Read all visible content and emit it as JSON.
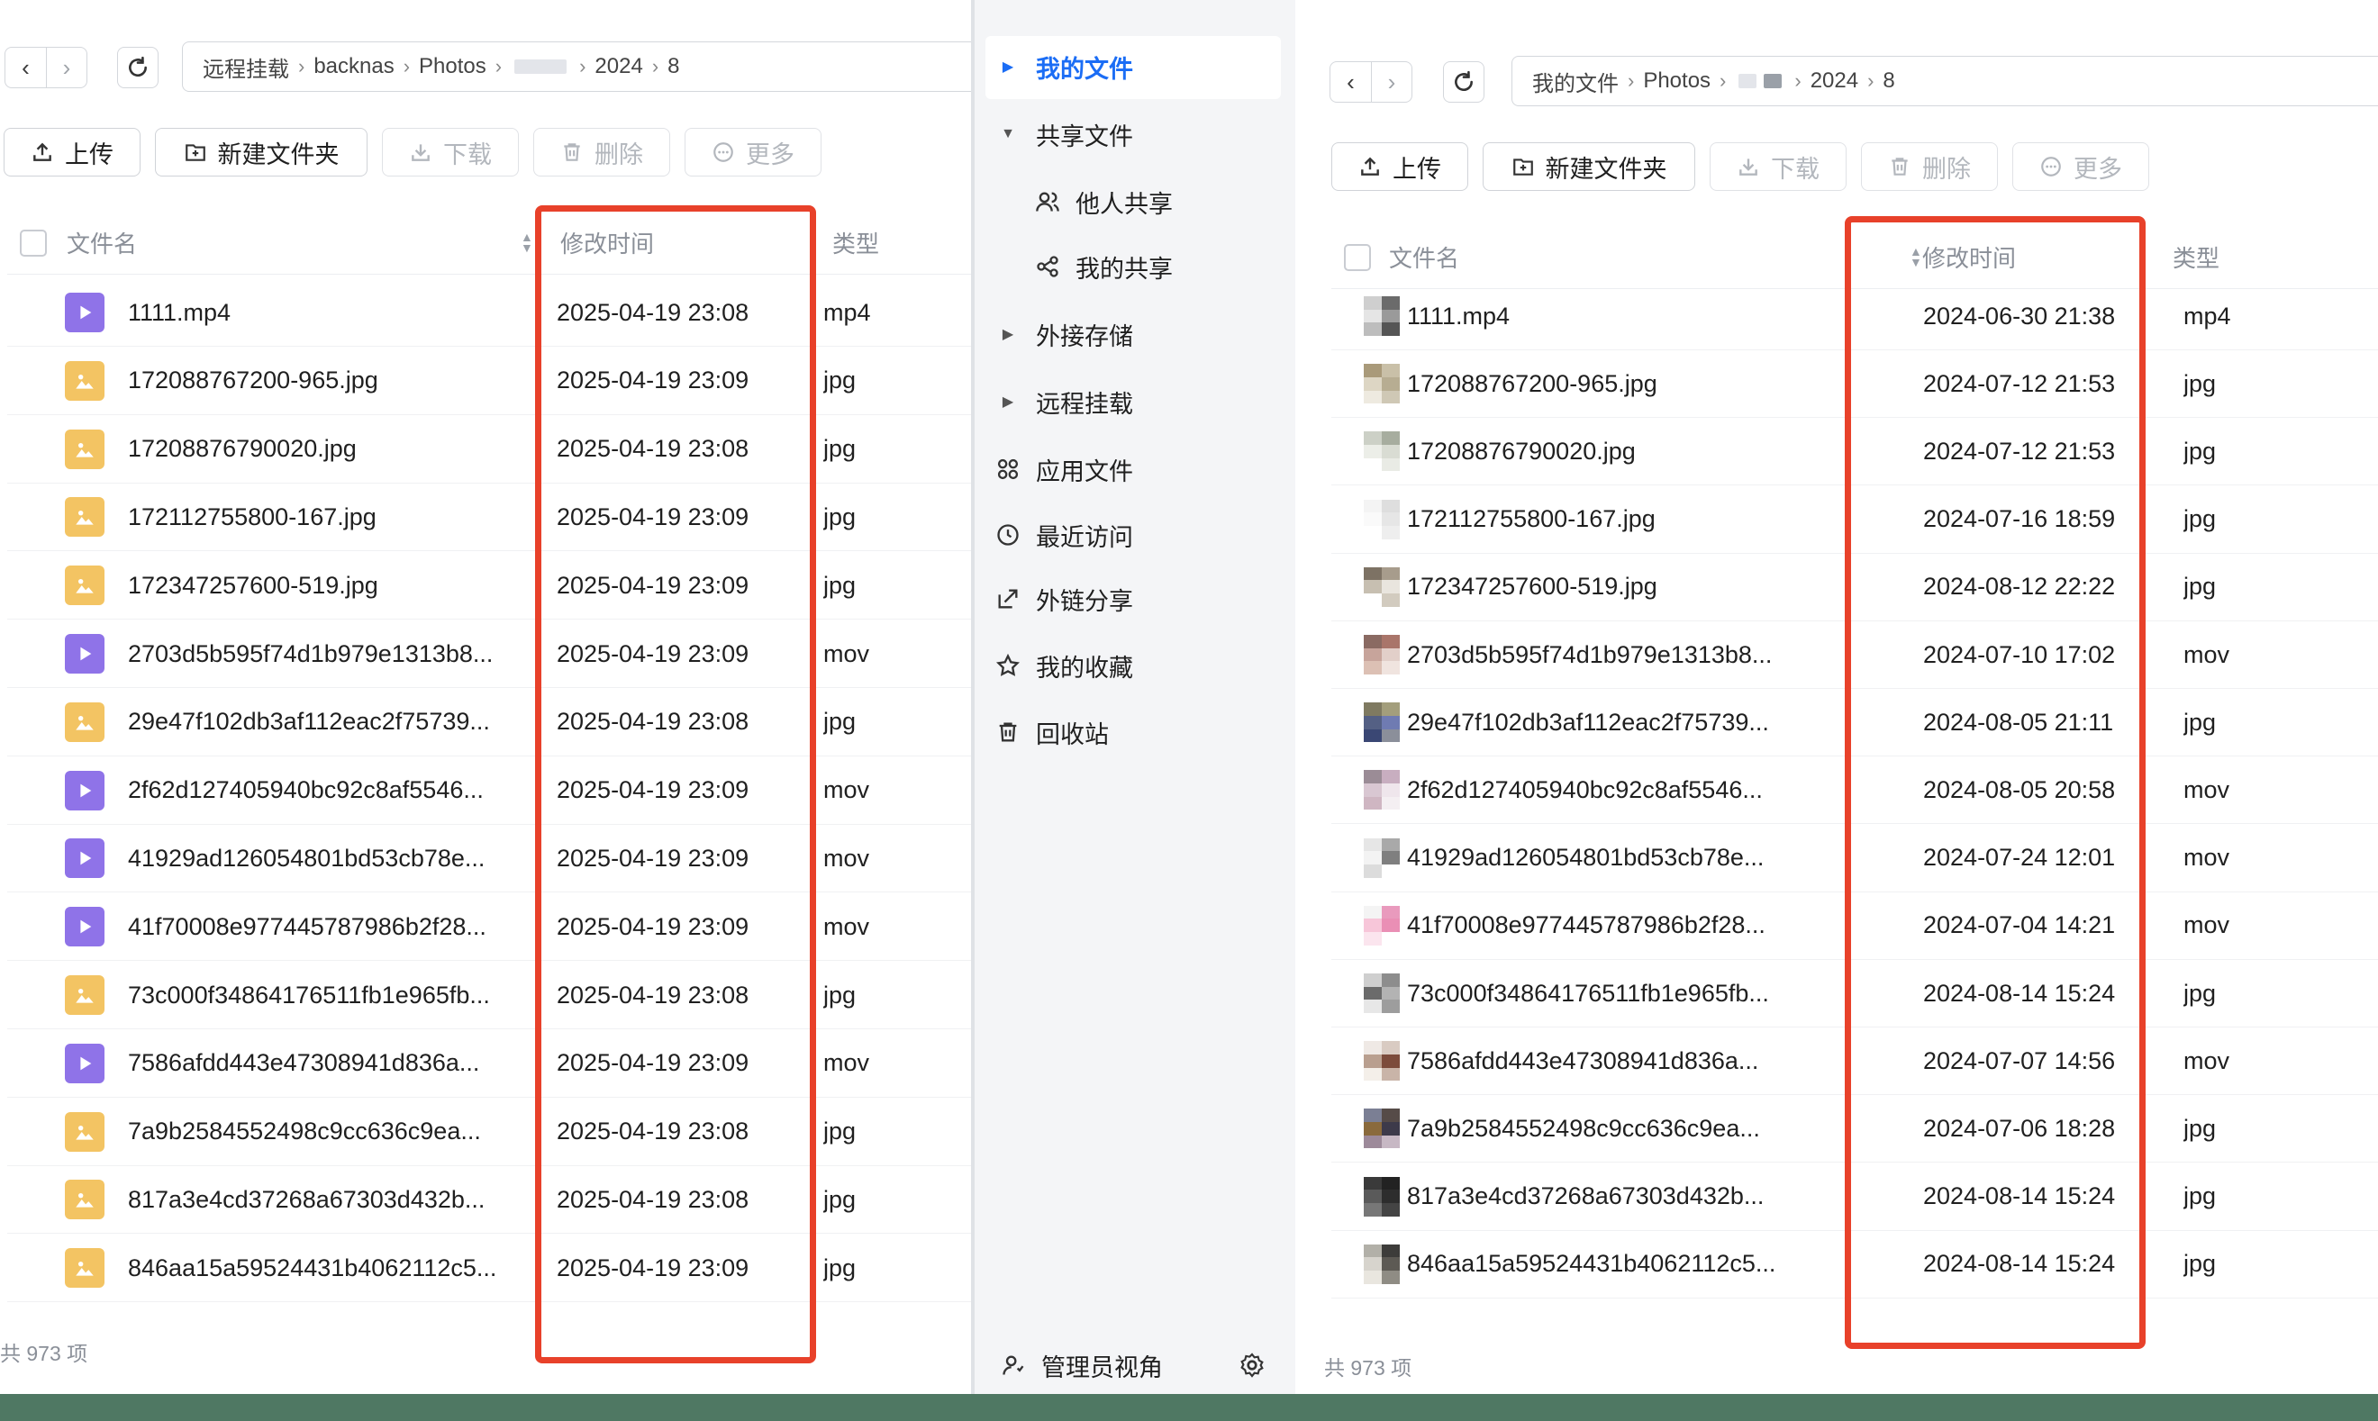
{
  "left": {
    "breadcrumb": [
      "远程挂载",
      "backnas",
      "Photos",
      "2024",
      "8"
    ],
    "toolbar": {
      "upload": "上传",
      "new_folder": "新建文件夹",
      "download": "下载",
      "delete": "删除",
      "more": "更多"
    },
    "columns": {
      "name": "文件名",
      "modified": "修改时间",
      "type": "类型"
    },
    "files": [
      {
        "name": "1111.mp4",
        "modified": "2025-04-19 23:08",
        "type": "mp4",
        "kind": "video"
      },
      {
        "name": "172088767200-965.jpg",
        "modified": "2025-04-19 23:09",
        "type": "jpg",
        "kind": "image"
      },
      {
        "name": "17208876790020.jpg",
        "modified": "2025-04-19 23:08",
        "type": "jpg",
        "kind": "image"
      },
      {
        "name": "172112755800-167.jpg",
        "modified": "2025-04-19 23:09",
        "type": "jpg",
        "kind": "image"
      },
      {
        "name": "172347257600-519.jpg",
        "modified": "2025-04-19 23:09",
        "type": "jpg",
        "kind": "image"
      },
      {
        "name": "2703d5b595f74d1b979e1313b8...",
        "modified": "2025-04-19 23:09",
        "type": "mov",
        "kind": "video"
      },
      {
        "name": "29e47f102db3af112eac2f75739...",
        "modified": "2025-04-19 23:08",
        "type": "jpg",
        "kind": "image"
      },
      {
        "name": "2f62d127405940bc92c8af5546...",
        "modified": "2025-04-19 23:09",
        "type": "mov",
        "kind": "video"
      },
      {
        "name": "41929ad126054801bd53cb78e...",
        "modified": "2025-04-19 23:09",
        "type": "mov",
        "kind": "video"
      },
      {
        "name": "41f70008e977445787986b2f28...",
        "modified": "2025-04-19 23:09",
        "type": "mov",
        "kind": "video"
      },
      {
        "name": "73c000f34864176511fb1e965fb...",
        "modified": "2025-04-19 23:08",
        "type": "jpg",
        "kind": "image"
      },
      {
        "name": "7586afdd443e47308941d836a...",
        "modified": "2025-04-19 23:09",
        "type": "mov",
        "kind": "video"
      },
      {
        "name": "7a9b2584552498c9cc636c9ea...",
        "modified": "2025-04-19 23:08",
        "type": "jpg",
        "kind": "image"
      },
      {
        "name": "817a3e4cd37268a67303d432b...",
        "modified": "2025-04-19 23:08",
        "type": "jpg",
        "kind": "image"
      },
      {
        "name": "846aa15a59524431b4062112c5...",
        "modified": "2025-04-19 23:09",
        "type": "jpg",
        "kind": "image"
      }
    ],
    "footer": "共 973 项"
  },
  "sidebar": {
    "items": [
      {
        "label": "我的文件",
        "icon": "triangle-right"
      },
      {
        "label": "共享文件",
        "icon": "triangle-down"
      },
      {
        "label": "他人共享",
        "icon": "users-icon"
      },
      {
        "label": "我的共享",
        "icon": "share-icon"
      },
      {
        "label": "外接存储",
        "icon": "triangle-right"
      },
      {
        "label": "远程挂载",
        "icon": "triangle-right"
      },
      {
        "label": "应用文件",
        "icon": "apps-icon"
      },
      {
        "label": "最近访问",
        "icon": "clock-icon"
      },
      {
        "label": "外链分享",
        "icon": "link-share-icon"
      },
      {
        "label": "我的收藏",
        "icon": "star-icon"
      },
      {
        "label": "回收站",
        "icon": "trash-icon"
      }
    ],
    "admin_label": "管理员视角"
  },
  "right": {
    "breadcrumb": [
      "我的文件",
      "Photos",
      "2024",
      "8"
    ],
    "toolbar": {
      "upload": "上传",
      "new_folder": "新建文件夹",
      "download": "下载",
      "delete": "删除",
      "more": "更多"
    },
    "columns": {
      "name": "文件名",
      "modified": "修改时间",
      "type": "类型"
    },
    "files": [
      {
        "name": "1111.mp4",
        "modified": "2024-06-30 21:38",
        "type": "mp4"
      },
      {
        "name": "172088767200-965.jpg",
        "modified": "2024-07-12 21:53",
        "type": "jpg"
      },
      {
        "name": "17208876790020.jpg",
        "modified": "2024-07-12 21:53",
        "type": "jpg"
      },
      {
        "name": "172112755800-167.jpg",
        "modified": "2024-07-16 18:59",
        "type": "jpg"
      },
      {
        "name": "172347257600-519.jpg",
        "modified": "2024-08-12 22:22",
        "type": "jpg"
      },
      {
        "name": "2703d5b595f74d1b979e1313b8...",
        "modified": "2024-07-10 17:02",
        "type": "mov"
      },
      {
        "name": "29e47f102db3af112eac2f75739...",
        "modified": "2024-08-05 21:11",
        "type": "jpg"
      },
      {
        "name": "2f62d127405940bc92c8af5546...",
        "modified": "2024-08-05 20:58",
        "type": "mov"
      },
      {
        "name": "41929ad126054801bd53cb78e...",
        "modified": "2024-07-24 12:01",
        "type": "mov"
      },
      {
        "name": "41f70008e977445787986b2f28...",
        "modified": "2024-07-04 14:21",
        "type": "mov"
      },
      {
        "name": "73c000f34864176511fb1e965fb...",
        "modified": "2024-08-14 15:24",
        "type": "jpg"
      },
      {
        "name": "7586afdd443e47308941d836a...",
        "modified": "2024-07-07 14:56",
        "type": "mov"
      },
      {
        "name": "7a9b2584552498c9cc636c9ea...",
        "modified": "2024-07-06 18:28",
        "type": "jpg"
      },
      {
        "name": "817a3e4cd37268a67303d432b...",
        "modified": "2024-08-14 15:24",
        "type": "jpg"
      },
      {
        "name": "846aa15a59524431b4062112c5...",
        "modified": "2024-08-14 15:24",
        "type": "jpg"
      }
    ],
    "footer": "共 973 项"
  },
  "colors": {
    "accent": "#1b6df5",
    "highlight_box": "#e8412a",
    "video_icon": "#8f73e8",
    "image_icon": "#f3c463"
  }
}
